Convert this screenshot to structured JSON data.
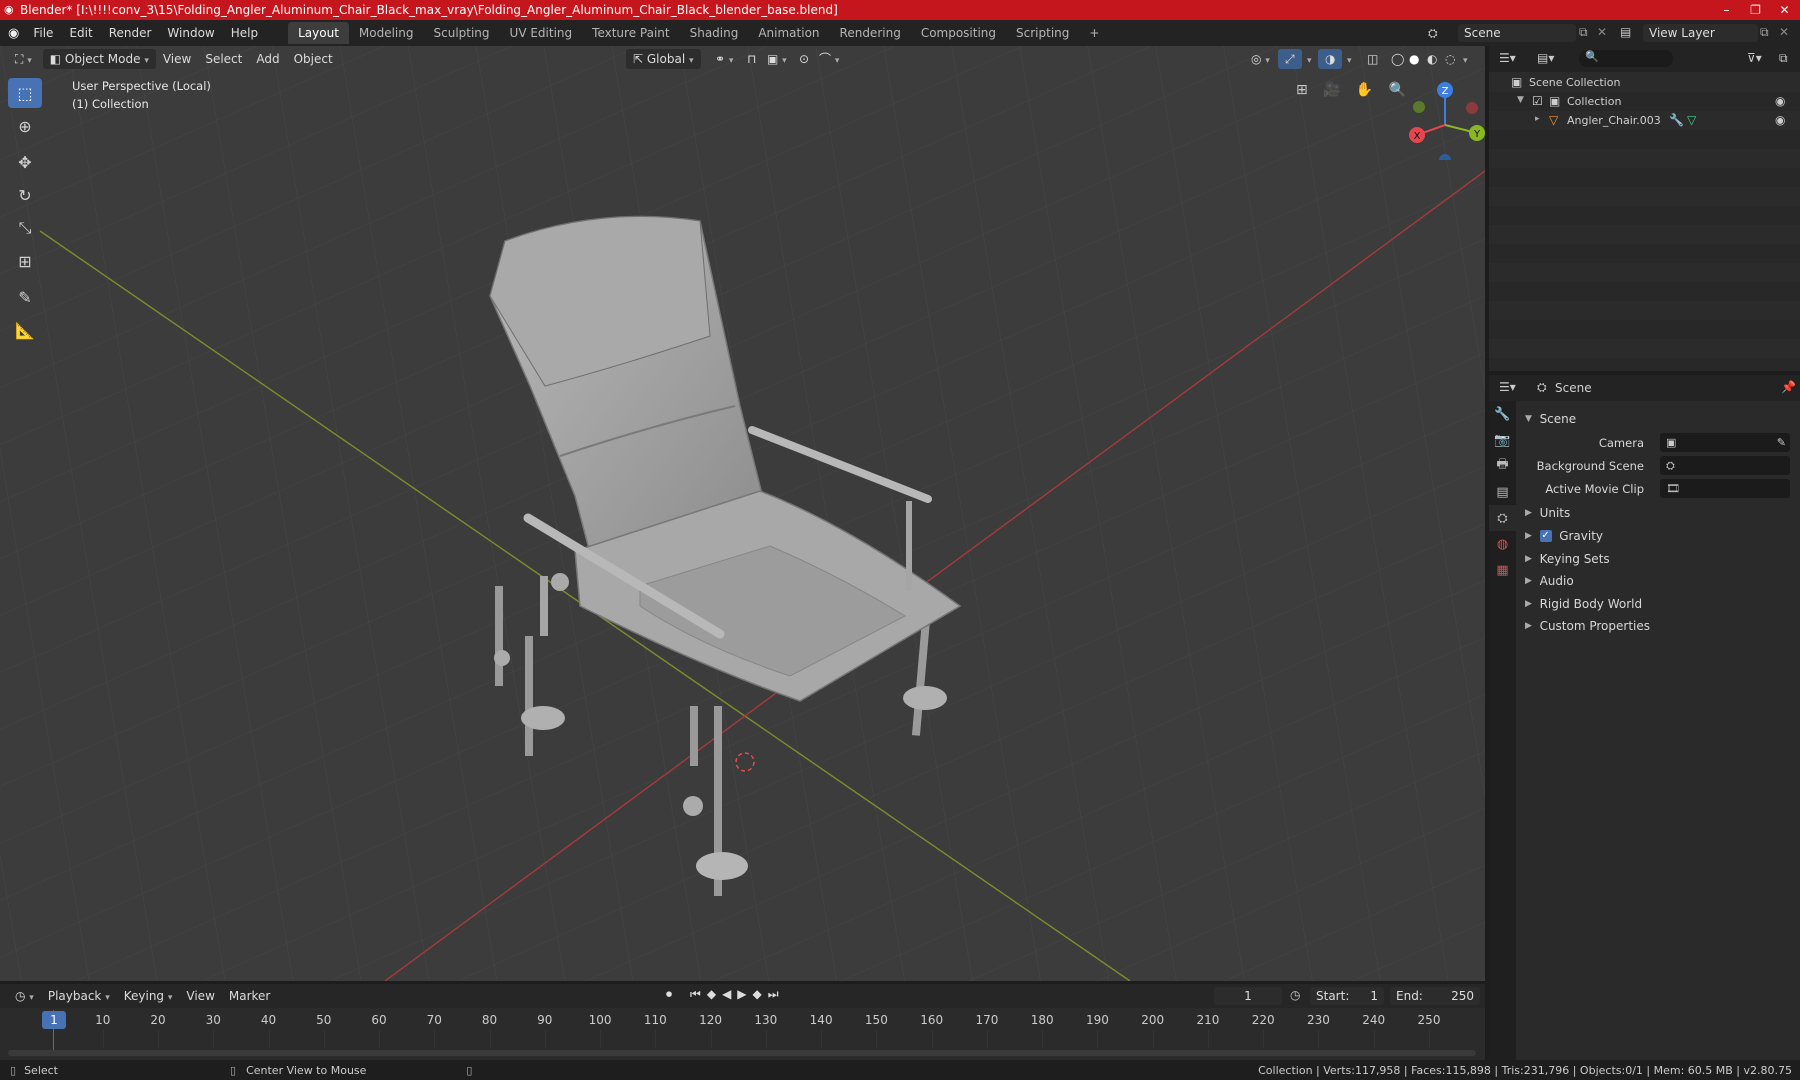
{
  "title": "Blender* [I:\\!!!!conv_3\\15\\Folding_Angler_Aluminum_Chair_Black_max_vray\\Folding_Angler_Aluminum_Chair_Black_blender_base.blend]",
  "window_controls": {
    "minimize": "–",
    "maximize": "❐",
    "close": "✕"
  },
  "menu": [
    "File",
    "Edit",
    "Render",
    "Window",
    "Help"
  ],
  "workspaces": [
    "Layout",
    "Modeling",
    "Sculpting",
    "UV Editing",
    "Texture Paint",
    "Shading",
    "Animation",
    "Rendering",
    "Compositing",
    "Scripting"
  ],
  "add_workspace": "+",
  "scene_selector": "Scene",
  "view_layer_selector": "View Layer",
  "viewport": {
    "mode": "Object Mode",
    "menus": [
      "View",
      "Select",
      "Add",
      "Object"
    ],
    "transform_orientation": "Global",
    "perspective_label": "User Perspective (Local)",
    "collection_label": "(1) Collection"
  },
  "gizmo": {
    "z": "Z",
    "y": "Y",
    "x": "X"
  },
  "outliner": {
    "root": "Scene Collection",
    "collection": "Collection",
    "object": "Angler_Chair.003"
  },
  "properties": {
    "header_title": "Scene",
    "section": "Scene",
    "fields": {
      "camera": "Camera",
      "background_scene": "Background Scene",
      "active_movie_clip": "Active Movie Clip"
    },
    "panels": {
      "units": "Units",
      "gravity": "Gravity",
      "keying_sets": "Keying Sets",
      "audio": "Audio",
      "rigid_body_world": "Rigid Body World",
      "custom_properties": "Custom Properties"
    },
    "gravity_checked": true
  },
  "timeline": {
    "menus": [
      "Playback",
      "Keying",
      "View",
      "Marker"
    ],
    "current_frame": "1",
    "start_label": "Start:",
    "start": "1",
    "end_label": "End:",
    "end": "250",
    "ticks": [
      "1",
      "10",
      "20",
      "30",
      "40",
      "50",
      "60",
      "70",
      "80",
      "90",
      "100",
      "110",
      "120",
      "130",
      "140",
      "150",
      "160",
      "170",
      "180",
      "190",
      "200",
      "210",
      "220",
      "230",
      "240",
      "250"
    ]
  },
  "statusbar": {
    "select": "Select",
    "center_view": "Center View to Mouse",
    "stats": "Collection | Verts:117,958 | Faces:115,898 | Tris:231,796 | Objects:0/1 | Mem: 60.5 MB | v2.80.75"
  },
  "colors": {
    "title_bar": "#c4161c",
    "accent": "#4772b3",
    "x_axis": "#e8464f",
    "y_axis": "#8ab823",
    "z_axis": "#3d7ee0"
  }
}
